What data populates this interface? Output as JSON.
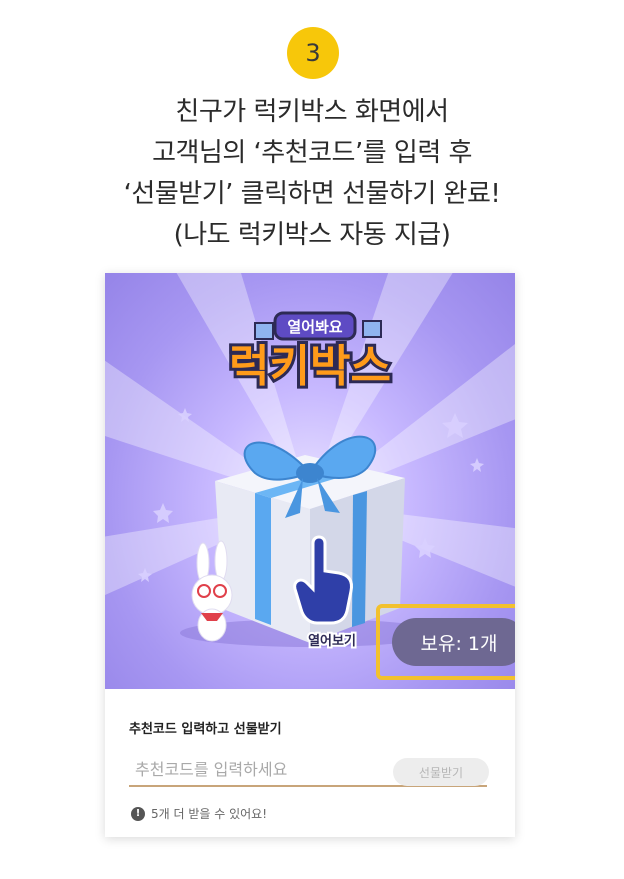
{
  "step": {
    "number": "3"
  },
  "instructions": {
    "line1": "친구가 럭키박스 화면에서",
    "line2": "고객님의 ‘추천코드’를 입력 후",
    "line3": "‘선물받기’ 클릭하면 선물하기 완료!",
    "line4": "(나도 럭키박스 자동 지급)"
  },
  "hero": {
    "banner_small": "열어봐요",
    "banner_title": "럭키박스",
    "open_label": "열어보기",
    "owned_label": "보유: 1개"
  },
  "form": {
    "title": "추천코드 입력하고 선물받기",
    "input_placeholder": "추천코드를 입력하세요",
    "input_value": "",
    "button_label": "선물받기",
    "notice": "5개 더 받을 수 있어요!"
  },
  "colors": {
    "accent_yellow": "#f7c70a",
    "highlight_border": "#f2c12e",
    "hero_purple": "#a797f2",
    "gift_blue": "#5aa8f0",
    "owned_pill": "#6e6892"
  },
  "icons": {
    "pointer": "hand-pointer-icon",
    "notice": "exclamation-circle-icon",
    "mascot": "rabbit-mascot"
  }
}
